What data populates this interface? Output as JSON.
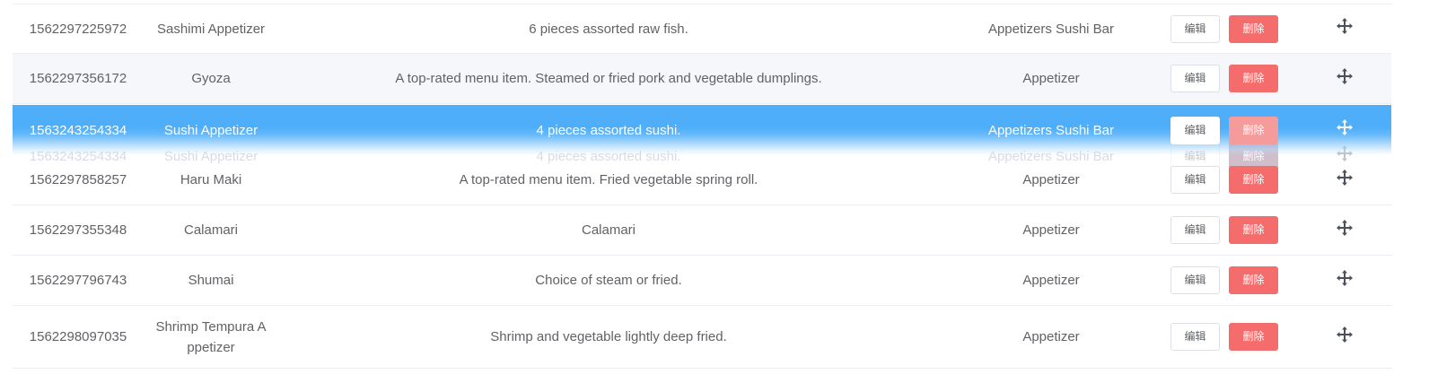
{
  "rows": [
    {
      "id": "1562297225972",
      "name": "Sashimi Appetizer",
      "desc": "6 pieces assorted raw fish.",
      "category": "Appetizers Sushi Bar",
      "edit": "编辑",
      "del": "删除"
    },
    {
      "id": "1562297356172",
      "name": "Gyoza",
      "desc": "A top-rated menu item. Steamed or fried pork and vegetable dumplings.",
      "category": "Appetizer",
      "edit": "编辑",
      "del": "删除"
    },
    {
      "id": "1562297858257",
      "name": "Haru Maki",
      "desc": "A top-rated menu item. Fried vegetable spring roll.",
      "category": "Appetizer",
      "edit": "编辑",
      "del": "删除"
    },
    {
      "id": "1562297355348",
      "name": "Calamari",
      "desc": "Calamari",
      "category": "Appetizer",
      "edit": "编辑",
      "del": "删除"
    },
    {
      "id": "1562297796743",
      "name": "Shumai",
      "desc": "Choice of steam or fried.",
      "category": "Appetizer",
      "edit": "编辑",
      "del": "删除"
    },
    {
      "id": "1562298097035",
      "name": "Shrimp Tempura A ppetizer",
      "desc": "Shrimp and vegetable lightly deep fried.",
      "category": "Appetizer",
      "edit": "编辑",
      "del": "删除"
    }
  ],
  "dragging_row": {
    "id": "1563243254334",
    "name": "Sushi Appetizer",
    "desc": "4 pieces assorted sushi.",
    "category": "Appetizers Sushi Bar",
    "edit": "编辑",
    "del": "删除"
  },
  "ghost_row": {
    "id": "1563243254334",
    "name": "Sushi Appetizer",
    "desc": "4 pieces assorted sushi.",
    "category": "Appetizers Sushi Bar",
    "edit": "编辑",
    "del": "删除"
  },
  "icons": {
    "drag_handle": "move-arrows-icon"
  },
  "colors": {
    "accent": "#4eaef9",
    "danger": "#f56c6c",
    "text": "#606266",
    "stripe": "#f5f7fa"
  }
}
